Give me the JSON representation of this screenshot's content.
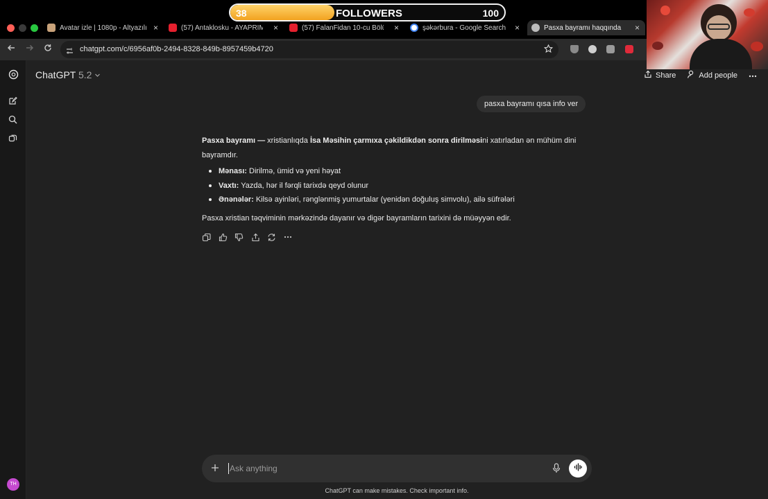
{
  "browser": {
    "tabs": [
      {
        "title": "Avatar izle | 1080p - Altyazılı",
        "favicon_color": "#c8a27a"
      },
      {
        "title": "(57) Antaklosku - AYAPRİMA",
        "favicon_color": "#e5202e"
      },
      {
        "title": "(57) FalanFidan 10-cu Bölüm",
        "favicon_color": "#e5202e"
      },
      {
        "title": "şəkərbura - Google Search",
        "favicon_color": "#4285f4"
      },
      {
        "title": "Pasxa bayramı haqqında",
        "favicon_color": "#bdbdbd"
      }
    ],
    "close_glyph": "×",
    "url": "chatgpt.com/c/6956af0b-2494-8328-849b-8957459b4720"
  },
  "followers_widget": {
    "current": "38",
    "label": "FOLLOWERS",
    "goal": "100",
    "progress": 0.38,
    "fill_color": "#f2a21f"
  },
  "app": {
    "model_name": "ChatGPT",
    "model_version": "5.2",
    "share_label": "Share",
    "add_people_label": "Add people",
    "user_avatar_initials": "TH",
    "accent_color": "#c54ad0"
  },
  "conversation": {
    "user_message": "pasxa bayramı qısa info ver",
    "answer": {
      "intro_bold": "Pasxa bayramı —",
      "intro_text1": " xristianlıqda ",
      "intro_bold2": "İsa Məsihin çarmıxa çəkildikdən sonra dirilməsi",
      "intro_text2": "ni xatırladan ən mühüm dini bayramdır.",
      "bullets": [
        {
          "label": "Mənası:",
          "text": " Dirilmə, ümid və yeni həyat"
        },
        {
          "label": "Vaxtı:",
          "text": " Yazda, hər il fərqli tarixdə qeyd olunur"
        },
        {
          "label": "Ənənələr:",
          "text": " Kilsə ayinləri, rənglənmiş yumurtalar (yenidən doğuluş simvolu), ailə süfrələri"
        }
      ],
      "closing": "Pasxa xristian təqviminin mərkəzində dayanır və digər bayramların tarixini də müəyyən edir."
    }
  },
  "composer": {
    "placeholder": "Ask anything",
    "disclaimer": "ChatGPT can make mistakes. Check important info."
  }
}
